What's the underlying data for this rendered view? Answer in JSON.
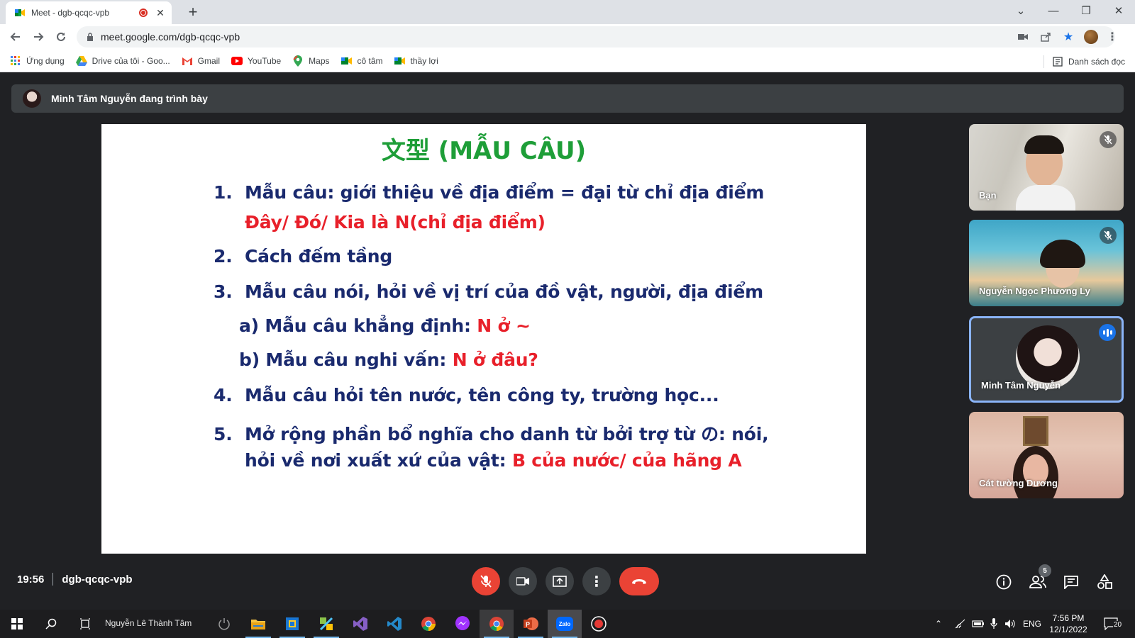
{
  "browser": {
    "tab_title": "Meet - dgb-qcqc-vpb",
    "url": "meet.google.com/dgb-qcqc-vpb",
    "bookmarks": [
      {
        "label": "Ứng dụng",
        "icon": "apps-grid-icon"
      },
      {
        "label": "Drive của tôi - Goo...",
        "icon": "google-drive-icon"
      },
      {
        "label": "Gmail",
        "icon": "gmail-icon"
      },
      {
        "label": "YouTube",
        "icon": "youtube-icon"
      },
      {
        "label": "Maps",
        "icon": "google-maps-icon"
      },
      {
        "label": "cô tâm",
        "icon": "google-meet-icon"
      },
      {
        "label": "thầy lợi",
        "icon": "google-meet-icon"
      }
    ],
    "reading_list": "Danh sách đọc"
  },
  "meet": {
    "presenter_text": "Minh Tâm Nguyễn đang trình bày",
    "slide": {
      "title": "文型 (MẪU CÂU)",
      "items": [
        {
          "num": "1.",
          "text": "Mẫu câu: giới thiệu về địa điểm = đại từ chỉ địa điểm"
        },
        {
          "text_red": "Đây/ Đó/ Kia là N(chỉ địa điểm)"
        },
        {
          "num": "2.",
          "text": "Cách đếm tầng"
        },
        {
          "num": "3.",
          "text": "Mẫu câu nói, hỏi về vị trí của đồ vật, người, địa điểm"
        },
        {
          "text": "a) Mẫu câu khẳng định: ",
          "text_red": "N ở ~"
        },
        {
          "text": "b) Mẫu câu nghi vấn: ",
          "text_red": "N ở đâu?"
        },
        {
          "num": "4.",
          "text": "Mẫu câu hỏi tên nước, tên công ty, trường học..."
        },
        {
          "num": "5.",
          "text": "Mở rộng phần bổ nghĩa cho danh từ bởi trợ từ の: nói,"
        },
        {
          "text": "hỏi về nơi xuất xứ của vật: ",
          "text_red": "B của nước/ của hãng A"
        }
      ]
    },
    "participants": [
      {
        "name": "Bạn",
        "muted": true
      },
      {
        "name": "Nguyễn Ngọc Phương Ly",
        "muted": true
      },
      {
        "name": "Minh Tâm Nguyễn",
        "speaking": true
      },
      {
        "name": "Cát tường Dương",
        "muted": false
      }
    ],
    "time": "19:56",
    "meeting_code": "dgb-qcqc-vpb",
    "people_count": "5"
  },
  "taskbar": {
    "search_user": "Nguyễn Lê Thành Tâm",
    "language": "ENG",
    "time": "7:56 PM",
    "date": "12/1/2022",
    "notifications": "20"
  },
  "colors": {
    "meet_bg": "#202124",
    "slide_blue": "#1a2a6e",
    "slide_red": "#e8202a",
    "slide_green": "#1e9e38",
    "end_call_red": "#ea4335",
    "speaking_blue": "#1a73e8"
  }
}
